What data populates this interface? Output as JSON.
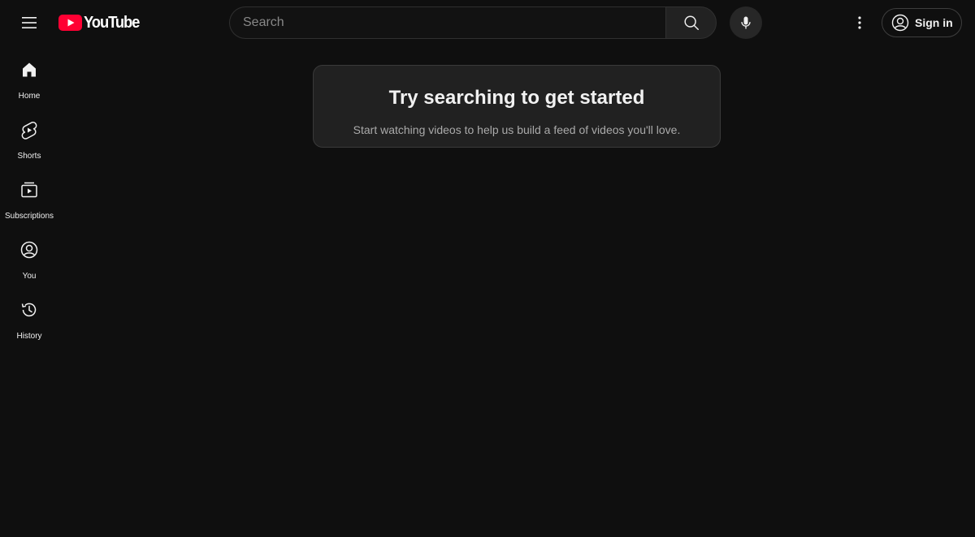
{
  "header": {
    "logo_text": "YouTube",
    "search": {
      "placeholder": "Search",
      "value": ""
    },
    "signin_label": "Sign in"
  },
  "sidebar": {
    "items": [
      {
        "label": "Home",
        "icon": "home-icon"
      },
      {
        "label": "Shorts",
        "icon": "shorts-icon"
      },
      {
        "label": "Subscriptions",
        "icon": "subscriptions-icon"
      },
      {
        "label": "You",
        "icon": "you-icon"
      },
      {
        "label": "History",
        "icon": "history-icon"
      }
    ]
  },
  "main": {
    "prompt_title": "Try searching to get started",
    "prompt_subtitle": "Start watching videos to help us build a feed of videos you'll love."
  },
  "colors": {
    "background": "#0f0f0f",
    "brand_red": "#ff0033",
    "card": "#212121"
  }
}
